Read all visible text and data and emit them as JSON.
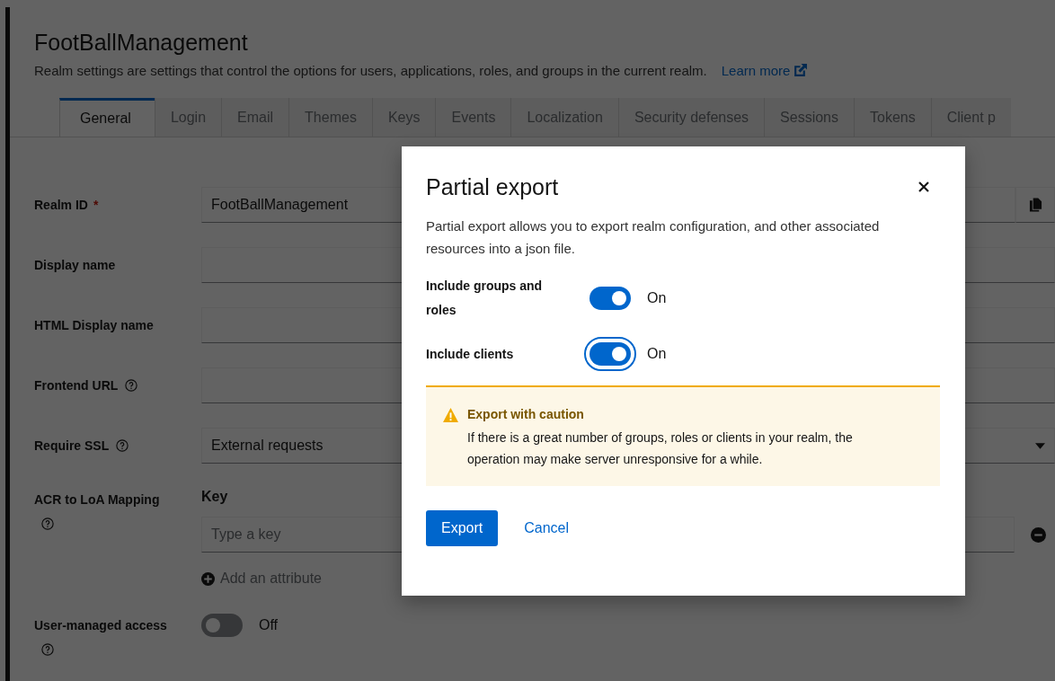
{
  "header": {
    "title": "FootBallManagement",
    "description": "Realm settings are settings that control the options for users, applications, roles, and groups in the current realm.",
    "learn_more": "Learn more"
  },
  "tabs": [
    {
      "label": "General",
      "selected": true
    },
    {
      "label": "Login",
      "selected": false
    },
    {
      "label": "Email",
      "selected": false
    },
    {
      "label": "Themes",
      "selected": false
    },
    {
      "label": "Keys",
      "selected": false
    },
    {
      "label": "Events",
      "selected": false
    },
    {
      "label": "Localization",
      "selected": false
    },
    {
      "label": "Security defenses",
      "selected": false
    },
    {
      "label": "Sessions",
      "selected": false
    },
    {
      "label": "Tokens",
      "selected": false
    },
    {
      "label": "Client p",
      "selected": false
    }
  ],
  "fields": [
    {
      "kind": "text",
      "label": "Realm ID",
      "required_mark": "*",
      "help": false,
      "value": "FootBallManagement",
      "copy": true
    },
    {
      "kind": "text",
      "label": "Display name",
      "help": false
    },
    {
      "kind": "text",
      "label": "HTML Display name",
      "help": false
    },
    {
      "kind": "text",
      "label": "Frontend URL",
      "help": true
    },
    {
      "kind": "select",
      "label": "Require SSL",
      "help": true,
      "value": "External requests"
    },
    {
      "kind": "keyvalue",
      "label": "ACR to LoA Mapping",
      "help": true,
      "column_header": "Key",
      "placeholder": "Type a key",
      "add_link": "Add an attribute"
    },
    {
      "kind": "switch",
      "label": "User-managed access",
      "help": true,
      "on": false,
      "state_label": "Off"
    }
  ],
  "modal": {
    "title": "Partial export",
    "description": "Partial export allows you to export realm configuration, and other associated resources into a json file.",
    "toggles": [
      {
        "label": "Include groups and roles",
        "on": true,
        "focused": false,
        "state_label": "On"
      },
      {
        "label": "Include clients",
        "on": true,
        "focused": true,
        "state_label": "On"
      }
    ],
    "alert": {
      "title": "Export with caution",
      "message": "If there is a great number of groups, roles or clients in your realm, the operation may make server unresponsive for a while."
    },
    "buttons": [
      {
        "label": "Export",
        "kind": "primary"
      },
      {
        "label": "Cancel",
        "kind": "link"
      }
    ]
  }
}
